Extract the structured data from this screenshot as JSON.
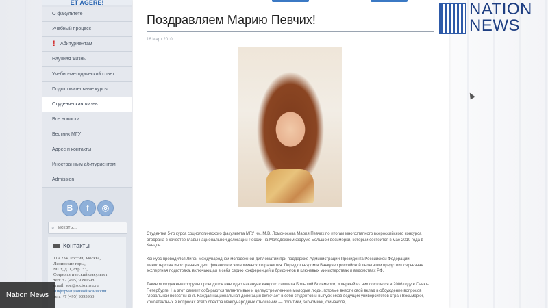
{
  "sidebar": {
    "logo_text": "ET AGERE!",
    "items": [
      {
        "label": "О факультете"
      },
      {
        "label": "Учебный процесс"
      },
      {
        "label": "Абитуриентам"
      },
      {
        "label": "Научная жизнь"
      },
      {
        "label": "Учебно-методический совет"
      },
      {
        "label": "Подготовительные курсы"
      },
      {
        "label": "Студенческая жизнь"
      },
      {
        "label": "Все новости"
      },
      {
        "label": "Вестник МГУ"
      },
      {
        "label": "Адрес и контакты"
      },
      {
        "label": "Иностранным абитуриентам"
      },
      {
        "label": "Admission"
      }
    ],
    "search": {
      "placeholder": "искать..."
    },
    "contacts": {
      "heading": "Контакты",
      "lines": [
        "119 234, Россия, Москва,",
        "Ленинские горы,",
        "МГУ, д. 1, стр. 33,",
        "Социологический факультет",
        "тел: +7 (495) 9390698",
        "email: soc@socio.msu.ru",
        "Информационной комиссии",
        "тел: +7 (495) 9395963"
      ]
    }
  },
  "social": {
    "vk": "В",
    "fb": "f",
    "ig": "◎"
  },
  "article": {
    "title": "Поздравляем Марию Певчих!",
    "date": "16 Март 2010",
    "paragraphs": [
      "Студентка 5-го курса социологического факультета МГУ им. М.В. Ломоносова Мария Певчих по итогам многоэтапного всероссийского конкурса отобрана в качестве главы национальной делегации России на Молодежном форуме Большой восьмерки, который состоится в мае 2010 года в Канаде.",
      "Конкурс проводился Лигой международной молодежной дипломатии при поддержке Администрации Президента Российской Федерации, министерства иностранных дел, финансов и экономического развития. Перед отъездом в Ванкувер российской делегации предстоит серьезная экспертная подготовка, включающая в себя серию конференций и брифингов в ключевых министерствах и ведомствах РФ.",
      "Такие молодежные форумы проводятся ежегодно накануне каждого саммита Большой Восьмерки, и первый из них состоялся в 2006 году в Санкт-Петербурге. На этот саммит собираются талантливые и целеустремленные молодые люди, готовые внести свой вклад в обсуждение вопросов глобальной повестки дня. Каждая национальная делегация включает в себя студентов и выпускников ведущих университетов стран Восьмерки, компетентных в вопросах всего спектра международных отношений — политики, экономики, финансов,"
    ]
  },
  "watermark": {
    "brand_line1": "NATION",
    "brand_line2": "NEWS",
    "badge": "Nation News"
  }
}
